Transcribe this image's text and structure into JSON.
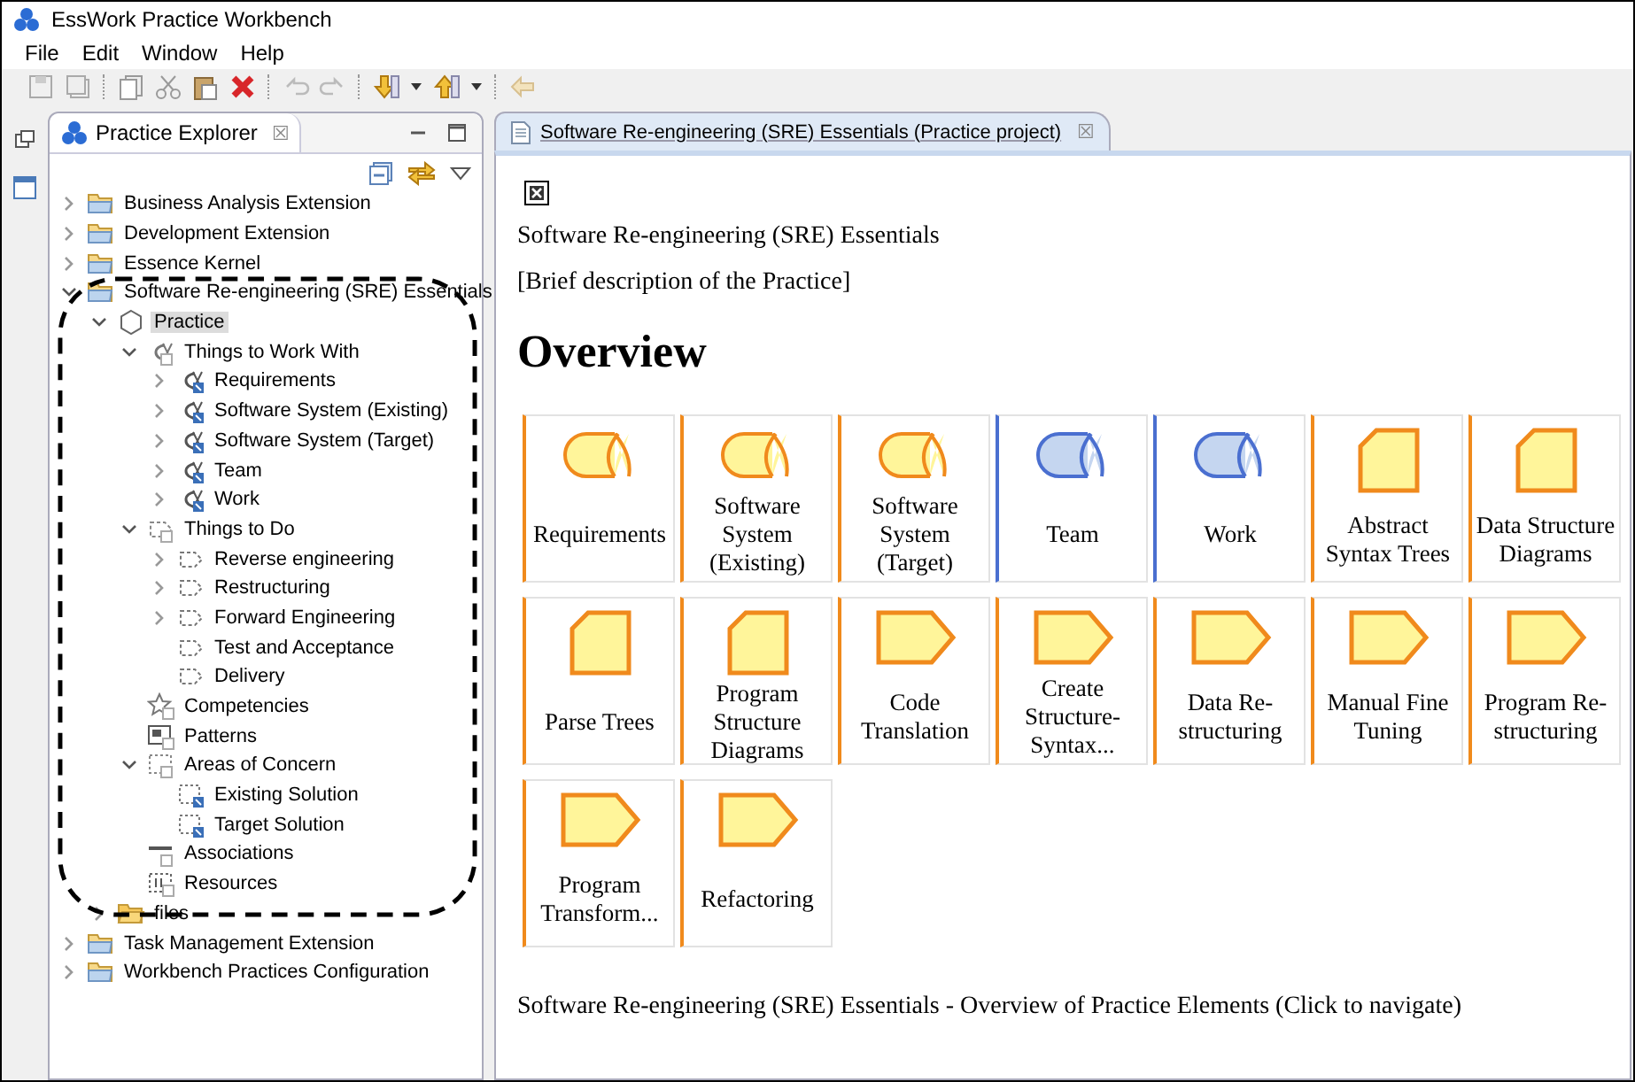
{
  "window": {
    "title": "EssWork Practice Workbench"
  },
  "menu": [
    "File",
    "Edit",
    "Window",
    "Help"
  ],
  "explorer": {
    "title": "Practice Explorer",
    "close": "☒",
    "tree": [
      {
        "label": "Business Analysis Extension",
        "kind": "folder",
        "expanded": false,
        "has_children": true,
        "selected": false
      },
      {
        "label": "Development Extension",
        "kind": "folder",
        "expanded": false,
        "has_children": true,
        "selected": false
      },
      {
        "label": "Essence Kernel",
        "kind": "folder",
        "expanded": false,
        "has_children": true,
        "selected": false
      },
      {
        "label": "Software Re-engineering (SRE) Essentials",
        "kind": "folder",
        "expanded": true,
        "has_children": true,
        "selected": false,
        "children": [
          {
            "label": "Practice",
            "kind": "practice",
            "expanded": true,
            "has_children": true,
            "selected": true,
            "children": [
              {
                "label": "Things to Work With",
                "kind": "alpha-group",
                "expanded": true,
                "has_children": true,
                "selected": false,
                "children": [
                  {
                    "label": "Requirements",
                    "kind": "alpha",
                    "expanded": false,
                    "has_children": true,
                    "selected": false
                  },
                  {
                    "label": "Software System (Existing)",
                    "kind": "alpha",
                    "expanded": false,
                    "has_children": true,
                    "selected": false
                  },
                  {
                    "label": "Software System (Target)",
                    "kind": "alpha",
                    "expanded": false,
                    "has_children": true,
                    "selected": false
                  },
                  {
                    "label": "Team",
                    "kind": "alpha",
                    "expanded": false,
                    "has_children": true,
                    "selected": false
                  },
                  {
                    "label": "Work",
                    "kind": "alpha",
                    "expanded": false,
                    "has_children": true,
                    "selected": false
                  }
                ]
              },
              {
                "label": "Things to Do",
                "kind": "activity-group",
                "expanded": true,
                "has_children": true,
                "selected": false,
                "children": [
                  {
                    "label": "Reverse engineering",
                    "kind": "activity",
                    "expanded": false,
                    "has_children": true,
                    "selected": false
                  },
                  {
                    "label": "Restructuring",
                    "kind": "activity",
                    "expanded": false,
                    "has_children": true,
                    "selected": false
                  },
                  {
                    "label": "Forward Engineering",
                    "kind": "activity",
                    "expanded": false,
                    "has_children": true,
                    "selected": false
                  },
                  {
                    "label": "Test and Acceptance",
                    "kind": "activity",
                    "expanded": false,
                    "has_children": false,
                    "selected": false
                  },
                  {
                    "label": "Delivery",
                    "kind": "activity",
                    "expanded": false,
                    "has_children": false,
                    "selected": false
                  }
                ]
              },
              {
                "label": "Competencies",
                "kind": "competency",
                "expanded": false,
                "has_children": false,
                "selected": false
              },
              {
                "label": "Patterns",
                "kind": "pattern",
                "expanded": false,
                "has_children": false,
                "selected": false
              },
              {
                "label": "Areas of Concern",
                "kind": "concern-group",
                "expanded": true,
                "has_children": true,
                "selected": false,
                "children": [
                  {
                    "label": "Existing Solution",
                    "kind": "concern",
                    "expanded": false,
                    "has_children": false,
                    "selected": false
                  },
                  {
                    "label": "Target Solution",
                    "kind": "concern",
                    "expanded": false,
                    "has_children": false,
                    "selected": false
                  }
                ]
              },
              {
                "label": "Associations",
                "kind": "association",
                "expanded": false,
                "has_children": false,
                "selected": false
              },
              {
                "label": "Resources",
                "kind": "resource",
                "expanded": false,
                "has_children": false,
                "selected": false
              }
            ]
          },
          {
            "label": "files",
            "kind": "open-folder",
            "expanded": false,
            "has_children": true,
            "selected": false
          }
        ]
      },
      {
        "label": "Task Management Extension",
        "kind": "folder",
        "expanded": false,
        "has_children": true,
        "selected": false
      },
      {
        "label": "Workbench Practices Configuration",
        "kind": "folder",
        "expanded": false,
        "has_children": true,
        "selected": false
      }
    ]
  },
  "editor": {
    "tab": "Software Re-engineering (SRE) Essentials (Practice project)",
    "close": "☒",
    "name": "Software Re-engineering (SRE) Essentials",
    "description": "[Brief description of the Practice]",
    "heading": "Overview",
    "cards": [
      {
        "label": "Requirements",
        "kind": "alpha",
        "color": "#f08a1c"
      },
      {
        "label": "Software System (Existing)",
        "kind": "alpha",
        "color": "#f08a1c"
      },
      {
        "label": "Software System (Target)",
        "kind": "alpha",
        "color": "#f08a1c"
      },
      {
        "label": "Team",
        "kind": "alpha",
        "color": "#4a6fd0"
      },
      {
        "label": "Work",
        "kind": "alpha",
        "color": "#4a6fd0"
      },
      {
        "label": "Abstract Syntax Trees",
        "kind": "work-product",
        "color": "#f08a1c"
      },
      {
        "label": "Data Structure Diagrams",
        "kind": "work-product",
        "color": "#f08a1c"
      },
      {
        "label": "Parse Trees",
        "kind": "work-product",
        "color": "#f08a1c"
      },
      {
        "label": "Program Structure Diagrams",
        "kind": "work-product",
        "color": "#f08a1c"
      },
      {
        "label": "Code Translation",
        "kind": "activity",
        "color": "#f08a1c"
      },
      {
        "label": "Create Structure-Syntax...",
        "kind": "activity",
        "color": "#f08a1c"
      },
      {
        "label": "Data Re-structuring",
        "kind": "activity",
        "color": "#f08a1c"
      },
      {
        "label": "Manual Fine Tuning",
        "kind": "activity",
        "color": "#f08a1c"
      },
      {
        "label": "Program Re-structuring",
        "kind": "activity",
        "color": "#f08a1c"
      },
      {
        "label": "Program Transform...",
        "kind": "activity",
        "color": "#f08a1c"
      },
      {
        "label": "Refactoring",
        "kind": "activity",
        "color": "#f08a1c"
      }
    ],
    "footer": "Software Re-engineering (SRE) Essentials - Overview of Practice Elements (Click to navigate)"
  }
}
